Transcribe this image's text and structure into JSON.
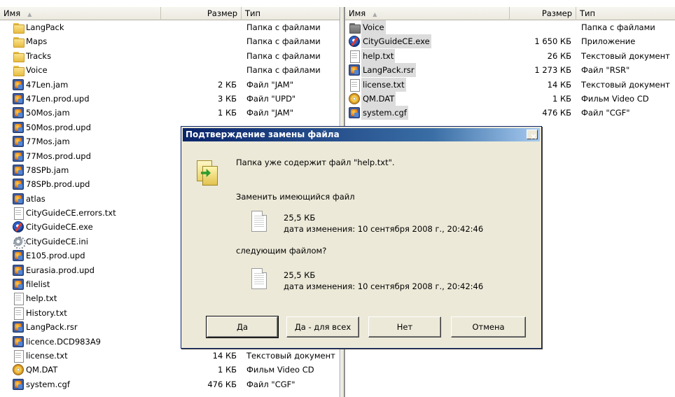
{
  "left_pane": {
    "columns": {
      "name": "Имя",
      "size": "Размер",
      "type": "Тип"
    },
    "rows": [
      {
        "icon": "folder-icon",
        "name": "LangPack",
        "size": "",
        "type": "Папка с файлами"
      },
      {
        "icon": "folder-icon",
        "name": "Maps",
        "size": "",
        "type": "Папка с файлами"
      },
      {
        "icon": "folder-icon",
        "name": "Tracks",
        "size": "",
        "type": "Папка с файлами"
      },
      {
        "icon": "folder-icon",
        "name": "Voice",
        "size": "",
        "type": "Папка с файлами"
      },
      {
        "icon": "app-file-icon",
        "name": "47Len.jam",
        "size": "2 КБ",
        "type": "Файл \"JAM\""
      },
      {
        "icon": "app-file-icon",
        "name": "47Len.prod.upd",
        "size": "3 КБ",
        "type": "Файл \"UPD\""
      },
      {
        "icon": "app-file-icon",
        "name": "50Mos.jam",
        "size": "1 КБ",
        "type": "Файл \"JAM\""
      },
      {
        "icon": "app-file-icon",
        "name": "50Mos.prod.upd",
        "size": "",
        "type": ""
      },
      {
        "icon": "app-file-icon",
        "name": "77Mos.jam",
        "size": "",
        "type": ""
      },
      {
        "icon": "app-file-icon",
        "name": "77Mos.prod.upd",
        "size": "",
        "type": ""
      },
      {
        "icon": "app-file-icon",
        "name": "78SPb.jam",
        "size": "",
        "type": ""
      },
      {
        "icon": "app-file-icon",
        "name": "78SPb.prod.upd",
        "size": "",
        "type": ""
      },
      {
        "icon": "app-file-icon",
        "name": "atlas",
        "size": "",
        "type": ""
      },
      {
        "icon": "text-file-icon",
        "name": "CityGuideCE.errors.txt",
        "size": "",
        "type": ""
      },
      {
        "icon": "exe-icon",
        "name": "CityGuideCE.exe",
        "size": "",
        "type": ""
      },
      {
        "icon": "settings-file-icon",
        "name": "CityGuideCE.ini",
        "size": "",
        "type": ""
      },
      {
        "icon": "app-file-icon",
        "name": "E105.prod.upd",
        "size": "",
        "type": ""
      },
      {
        "icon": "app-file-icon",
        "name": "Eurasia.prod.upd",
        "size": "",
        "type": ""
      },
      {
        "icon": "app-file-icon",
        "name": "filelist",
        "size": "",
        "type": ""
      },
      {
        "icon": "text-file-icon",
        "name": "help.txt",
        "size": "",
        "type": ""
      },
      {
        "icon": "text-file-icon",
        "name": "History.txt",
        "size": "",
        "type": ""
      },
      {
        "icon": "app-file-icon",
        "name": "LangPack.rsr",
        "size": "",
        "type": ""
      },
      {
        "icon": "app-file-icon",
        "name": "licence.DCD983A9",
        "size": "",
        "type": ""
      },
      {
        "icon": "text-file-icon",
        "name": "license.txt",
        "size": "14 КБ",
        "type": "Текстовый документ"
      },
      {
        "icon": "cd-icon",
        "name": "QM.DAT",
        "size": "1 КБ",
        "type": "Фильм Video CD"
      },
      {
        "icon": "app-file-icon",
        "name": "system.cgf",
        "size": "476 КБ",
        "type": "Файл \"CGF\""
      }
    ]
  },
  "right_pane": {
    "columns": {
      "name": "Имя",
      "size": "Размер",
      "type": "Тип"
    },
    "rows": [
      {
        "icon": "folder-icon",
        "name": "Voice",
        "size": "",
        "type": "Папка с файлами"
      },
      {
        "icon": "exe-icon",
        "name": "CityGuideCE.exe",
        "size": "1 650 КБ",
        "type": "Приложение"
      },
      {
        "icon": "text-file-icon",
        "name": "help.txt",
        "size": "26 КБ",
        "type": "Текстовый документ"
      },
      {
        "icon": "app-file-icon",
        "name": "LangPack.rsr",
        "size": "1 273 КБ",
        "type": "Файл \"RSR\""
      },
      {
        "icon": "text-file-icon",
        "name": "license.txt",
        "size": "14 КБ",
        "type": "Текстовый документ"
      },
      {
        "icon": "cd-icon",
        "name": "QM.DAT",
        "size": "1 КБ",
        "type": "Фильм Video CD"
      },
      {
        "icon": "app-file-icon",
        "name": "system.cgf",
        "size": "476 КБ",
        "type": "Файл \"CGF\""
      }
    ]
  },
  "dialog": {
    "title": "Подтверждение замены файла",
    "close_label": "×",
    "message": "Папка уже содержит файл \"help.txt\".",
    "replace_question": "Заменить имеющийся файл",
    "existing_size": "25,5 КБ",
    "existing_date": "дата изменения: 10 сентября 2008 г., 20:42:46",
    "with_label": "следующим файлом?",
    "new_size": "25,5 КБ",
    "new_date": "дата изменения: 10 сентября 2008 г., 20:42:46",
    "buttons": {
      "yes": "Да",
      "yes_all": "Да - для всех",
      "no": "Нет",
      "cancel": "Отмена"
    }
  }
}
